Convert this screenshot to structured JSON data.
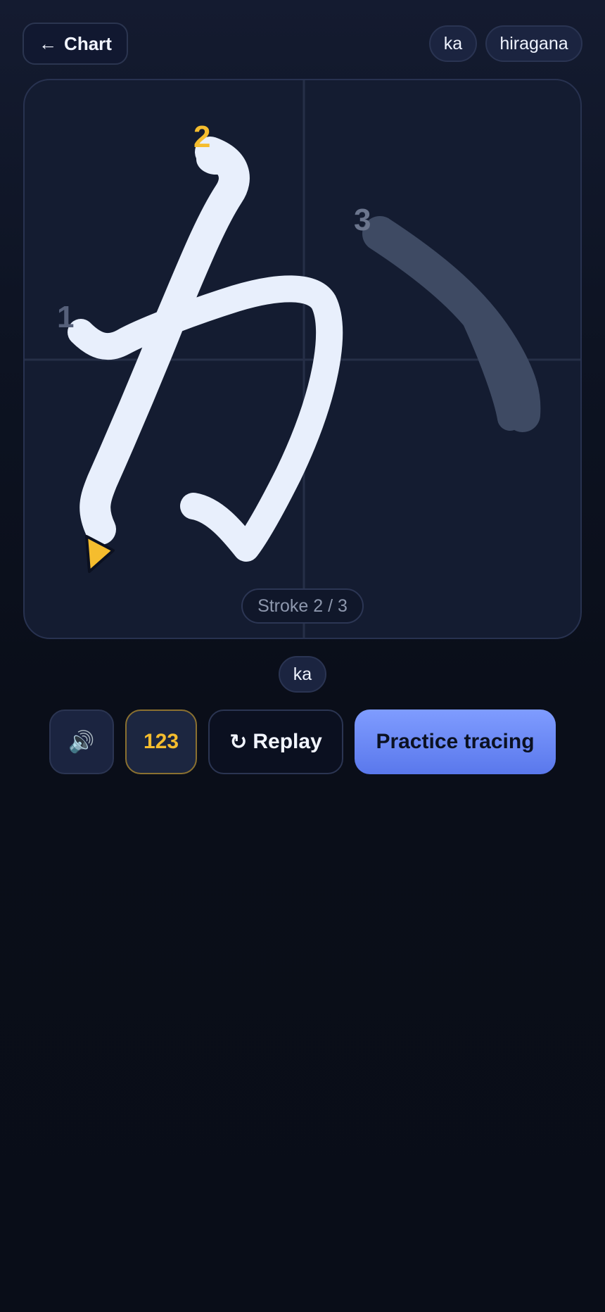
{
  "header": {
    "back_arrow": "←",
    "back_label": "Chart",
    "romaji_tag": "ka",
    "script_tag": "hiragana"
  },
  "canvas": {
    "character": "か",
    "stroke_numbers": [
      "1",
      "2",
      "3"
    ],
    "active_stroke": 2,
    "total_strokes": 3,
    "stroke_label": "Stroke 2 / 3"
  },
  "romaji_label": "ka",
  "controls": {
    "sound_icon": "🔊",
    "numbers_label": "123",
    "replay_icon": "↻",
    "replay_label": "Replay",
    "practice_label": "Practice tracing"
  },
  "colors": {
    "accent_yellow": "#f5bd2e",
    "primary_button": "#6a86f5",
    "drawn_stroke": "#e8effc",
    "ghost_stroke": "#3e4a63"
  }
}
